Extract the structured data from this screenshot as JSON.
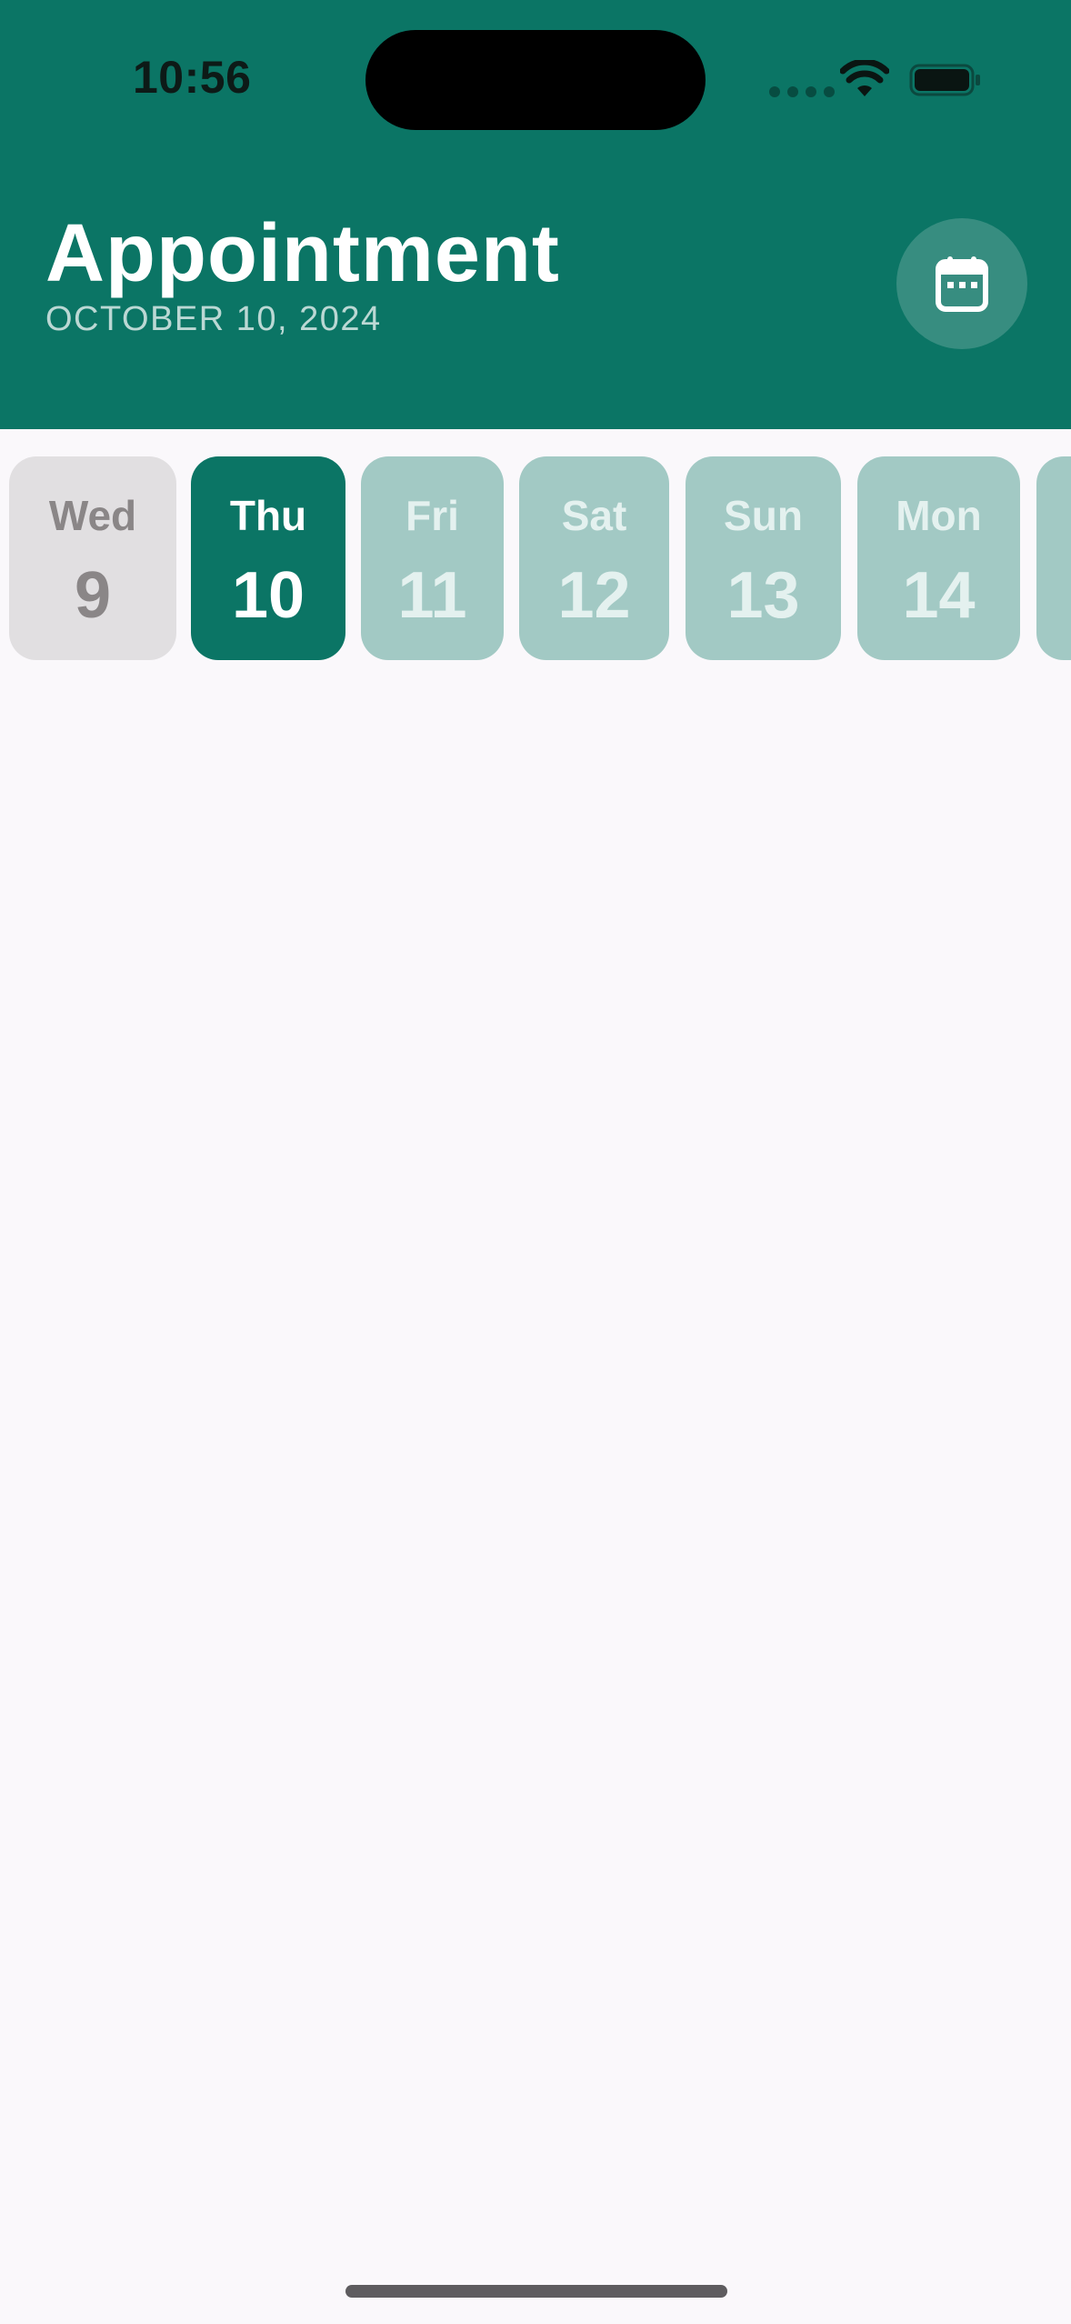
{
  "status_bar": {
    "time": "10:56"
  },
  "header": {
    "title": "Appointment",
    "subtitle": "OCTOBER 10, 2024",
    "calendar_icon": "calendar-icon"
  },
  "colors": {
    "brand": "#0b7565",
    "background": "#faf8fb",
    "past_day": "#e1dfe1",
    "future_day": "#a2c9c4"
  },
  "days": [
    {
      "name": "Wed",
      "number": "9",
      "state": "past"
    },
    {
      "name": "Thu",
      "number": "10",
      "state": "selected"
    },
    {
      "name": "Fri",
      "number": "11",
      "state": "future"
    },
    {
      "name": "Sat",
      "number": "12",
      "state": "future"
    },
    {
      "name": "Sun",
      "number": "13",
      "state": "future"
    },
    {
      "name": "Mon",
      "number": "14",
      "state": "future"
    },
    {
      "name": "",
      "number": "",
      "state": "future"
    }
  ]
}
